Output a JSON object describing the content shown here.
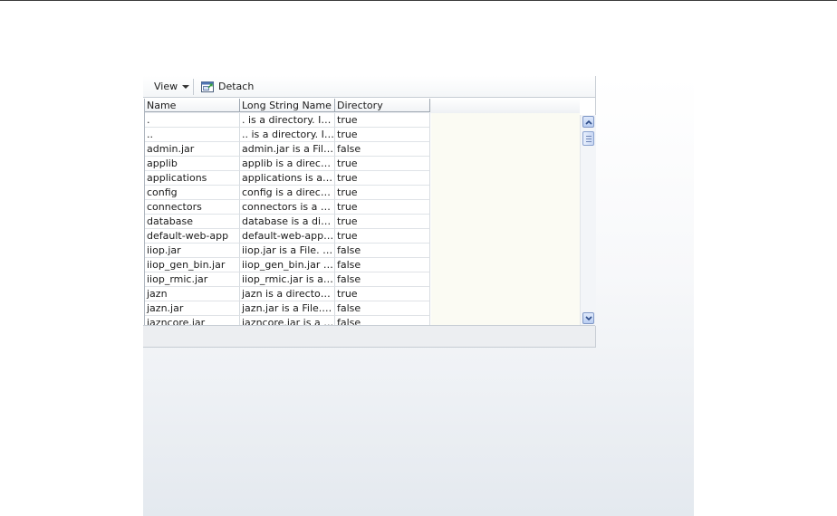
{
  "toolbar": {
    "view_label": "View",
    "detach_label": "Detach"
  },
  "table": {
    "columns": [
      "Name",
      "Long String Name",
      "Directory"
    ],
    "rows": [
      {
        "name": ".",
        "long": ". is a directory. It ...",
        "dir": "true"
      },
      {
        "name": "..",
        "long": ".. is a directory. It...",
        "dir": "true"
      },
      {
        "name": "admin.jar",
        "long": "admin.jar is a File. ...",
        "dir": "false"
      },
      {
        "name": "applib",
        "long": "applib is a director...",
        "dir": "true"
      },
      {
        "name": "applications",
        "long": "applications is a dir...",
        "dir": "true"
      },
      {
        "name": "config",
        "long": "config is a director...",
        "dir": "true"
      },
      {
        "name": "connectors",
        "long": "connectors is a dir...",
        "dir": "true"
      },
      {
        "name": "database",
        "long": "database is a direc...",
        "dir": "true"
      },
      {
        "name": "default-web-app",
        "long": "default-web-app is...",
        "dir": "true"
      },
      {
        "name": "iiop.jar",
        "long": "iiop.jar is a File. It ...",
        "dir": "false"
      },
      {
        "name": "iiop_gen_bin.jar",
        "long": "iiop_gen_bin.jar is ...",
        "dir": "false"
      },
      {
        "name": "iiop_rmic.jar",
        "long": "iiop_rmic.jar is a Fil...",
        "dir": "false"
      },
      {
        "name": "jazn",
        "long": "jazn is a directory,...",
        "dir": "true"
      },
      {
        "name": "jazn.jar",
        "long": "jazn.jar is a File. It...",
        "dir": "false"
      },
      {
        "name": "jazncore.jar",
        "long": "jazncore.jar is a Fil...",
        "dir": "false"
      }
    ]
  },
  "icons": {
    "view_dropdown": "chevron-down-icon",
    "detach": "detach-window-icon",
    "scroll_up": "chevron-up-icon",
    "scroll_down": "chevron-down-icon"
  },
  "colors": {
    "grid_filler": "#fbfbf3",
    "scrollbar_accent": "#7f97c6"
  }
}
